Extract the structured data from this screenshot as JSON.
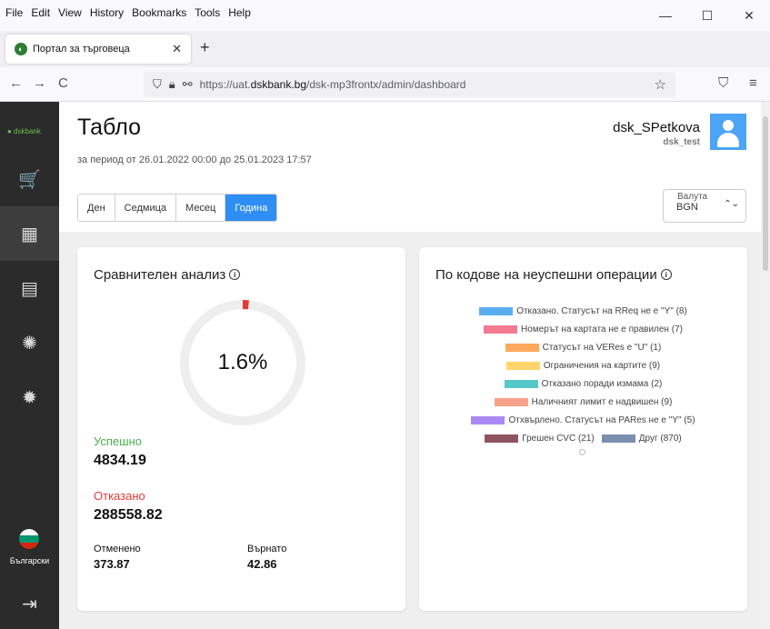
{
  "browser": {
    "menu": [
      "File",
      "Edit",
      "View",
      "History",
      "Bookmarks",
      "Tools",
      "Help"
    ],
    "window_controls": {
      "minimize": "—",
      "maximize": "☐",
      "close": "✕"
    },
    "tab": {
      "title": "Портал за търговеца",
      "close": "✕",
      "favicon": "dsk-logo-icon"
    },
    "new_tab": "+",
    "nav": {
      "back": "←",
      "forward": "→",
      "reload": "C"
    },
    "url": {
      "prefix": "https://uat.",
      "domain": "dskbank.bg",
      "path": "/dsk-mp3frontx/admin/dashboard"
    },
    "toolbar_right": {
      "pocket": "⛉",
      "menu": "≡"
    }
  },
  "sidebar": {
    "logo": "● dskbank",
    "items": [
      {
        "name": "cart-icon",
        "glyph": "🛒"
      },
      {
        "name": "dashboard-icon",
        "glyph": "▦",
        "active": true
      },
      {
        "name": "document-icon",
        "glyph": "▤"
      },
      {
        "name": "award-icon",
        "glyph": "✺"
      },
      {
        "name": "settings-icon",
        "glyph": "✹"
      }
    ],
    "language": "Български",
    "logout_glyph": "⇥"
  },
  "header": {
    "title": "Табло",
    "period": "за период от 26.01.2022 00:00 до 25.01.2023 17:57",
    "user_name": "dsk_SPetkova",
    "user_sub": "dsk_test",
    "period_buttons": [
      "Ден",
      "Седмица",
      "Месец",
      "Година"
    ],
    "active_period": "Година",
    "currency_label": "Валута",
    "currency_value": "BGN"
  },
  "comparative": {
    "title": "Сравнителен анализ",
    "gauge_value": "1.6%",
    "gauge_fraction": 0.016,
    "success_label": "Успешно",
    "success_value": "4834.19",
    "declined_label": "Отказано",
    "declined_value": "288558.82",
    "cancelled_label": "Отменено",
    "cancelled_value": "373.87",
    "returned_label": "Върнато",
    "returned_value": "42.86",
    "colors": {
      "success": "#4caf50",
      "declined": "#e53935",
      "gauge_track": "#eeeeee",
      "gauge_fill": "#e53935"
    }
  },
  "failures": {
    "title": "По кодове на неуспешни операции",
    "legend": [
      {
        "label": "Отказано. Статусът на RReq не е \"Y\" (8)",
        "color": "#5aaef0"
      },
      {
        "label": "Номерът на картата не е правилен (7)",
        "color": "#f47a92"
      },
      {
        "label": "Статусът на VERes e \"U\" (1)",
        "color": "#ffa75a"
      },
      {
        "label": "Ограничения на картите (9)",
        "color": "#ffd46a"
      },
      {
        "label": "Отказано поради измама (2)",
        "color": "#56c8c8"
      },
      {
        "label": "Наличният лимит е надвишен (9)",
        "color": "#f7a38c"
      },
      {
        "label": "Отхвърлено. Статусът на PARes не е \"Y\" (5)",
        "color": "#a98af5"
      },
      {
        "label": "Грешен CVC (21)",
        "color": "#8e5560"
      },
      {
        "label": "Друг (870)",
        "color": "#7b8fae"
      }
    ]
  }
}
